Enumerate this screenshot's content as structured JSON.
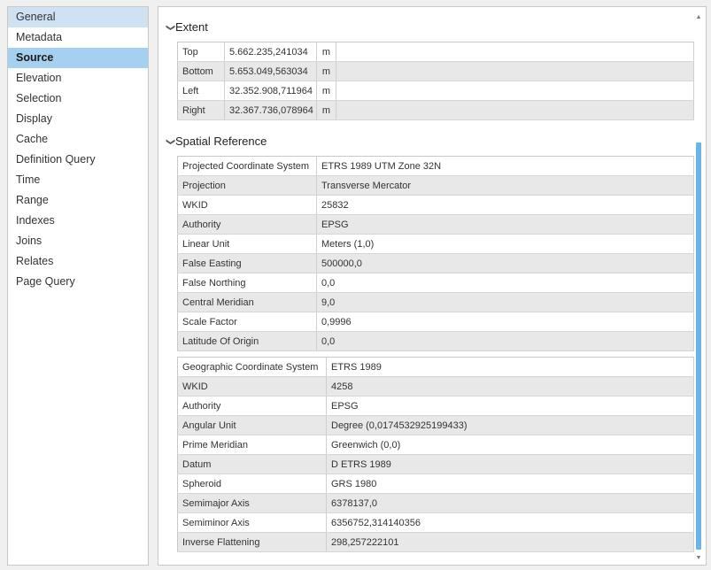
{
  "sidebar": {
    "items": [
      {
        "label": "General"
      },
      {
        "label": "Metadata"
      },
      {
        "label": "Source"
      },
      {
        "label": "Elevation"
      },
      {
        "label": "Selection"
      },
      {
        "label": "Display"
      },
      {
        "label": "Cache"
      },
      {
        "label": "Definition Query"
      },
      {
        "label": "Time"
      },
      {
        "label": "Range"
      },
      {
        "label": "Indexes"
      },
      {
        "label": "Joins"
      },
      {
        "label": "Relates"
      },
      {
        "label": "Page Query"
      }
    ],
    "selected": "Source",
    "hovered": "General"
  },
  "extent": {
    "title": "Extent",
    "rows": [
      {
        "label": "Top",
        "value": "5.662.235,241034",
        "unit": "m"
      },
      {
        "label": "Bottom",
        "value": "5.653.049,563034",
        "unit": "m"
      },
      {
        "label": "Left",
        "value": "32.352.908,711964",
        "unit": "m"
      },
      {
        "label": "Right",
        "value": "32.367.736,078964",
        "unit": "m"
      }
    ]
  },
  "spatial_reference": {
    "title": "Spatial Reference",
    "projected": [
      {
        "label": "Projected Coordinate System",
        "value": "ETRS 1989 UTM Zone 32N"
      },
      {
        "label": "Projection",
        "value": "Transverse Mercator"
      },
      {
        "label": "WKID",
        "value": "25832"
      },
      {
        "label": "Authority",
        "value": "EPSG"
      },
      {
        "label": "Linear Unit",
        "value": "Meters (1,0)"
      },
      {
        "label": "False Easting",
        "value": "500000,0"
      },
      {
        "label": "False Northing",
        "value": "0,0"
      },
      {
        "label": "Central Meridian",
        "value": "9,0"
      },
      {
        "label": "Scale Factor",
        "value": "0,9996"
      },
      {
        "label": "Latitude Of Origin",
        "value": "0,0"
      }
    ],
    "geographic": [
      {
        "label": "Geographic Coordinate System",
        "value": "ETRS 1989"
      },
      {
        "label": "WKID",
        "value": "4258"
      },
      {
        "label": "Authority",
        "value": "EPSG"
      },
      {
        "label": "Angular Unit",
        "value": "Degree (0,0174532925199433)"
      },
      {
        "label": "Prime Meridian",
        "value": "Greenwich (0,0)"
      },
      {
        "label": "Datum",
        "value": "D ETRS 1989"
      },
      {
        "label": "Spheroid",
        "value": "GRS 1980"
      },
      {
        "label": "Semimajor Axis",
        "value": "6378137,0"
      },
      {
        "label": "Semiminor Axis",
        "value": "6356752,314140356"
      },
      {
        "label": "Inverse Flattening",
        "value": "298,257222101"
      }
    ]
  },
  "colors": {
    "selected_bg": "#a6d0f0",
    "hover_bg": "#cfe2f3",
    "scroll_thumb": "#6ab4e8",
    "alt_row": "#e8e8e8"
  },
  "icons": {
    "section_toggle": "chevron-down-icon",
    "scroll_up": "arrow-up-icon",
    "scroll_down": "arrow-down-icon"
  }
}
